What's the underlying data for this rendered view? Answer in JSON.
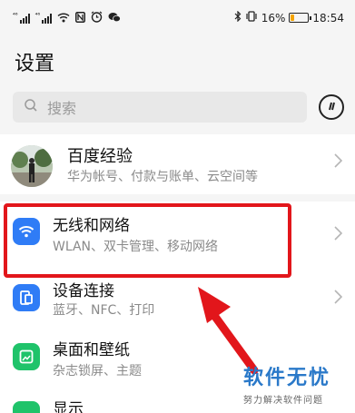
{
  "status_bar": {
    "signal_label_1": "⁴⁶",
    "signal_label_2": "⁴⁶",
    "battery_text": "16%",
    "battery_level": 0.16,
    "time": "18:54",
    "icons": [
      "signal-icon",
      "signal-icon",
      "wifi-icon",
      "nfc-icon",
      "alarm-icon",
      "wechat-icon",
      "bluetooth-icon",
      "vibrate-icon",
      "battery-icon"
    ]
  },
  "header": {
    "title": "设置"
  },
  "search": {
    "placeholder": "搜索"
  },
  "account": {
    "name": "百度经验",
    "subtitle": "华为帐号、付款与账单、云空间等"
  },
  "items": [
    {
      "title": "无线和网络",
      "subtitle": "WLAN、双卡管理、移动网络",
      "icon": "wifi-icon",
      "color": "#2f7cf6"
    },
    {
      "title": "设备连接",
      "subtitle": "蓝牙、NFC、打印",
      "icon": "device-connect-icon",
      "color": "#2f7cf6"
    },
    {
      "title": "桌面和壁纸",
      "subtitle": "杂志锁屏、主题",
      "icon": "wallpaper-icon",
      "color": "#1fc36a"
    },
    {
      "title": "显示",
      "subtitle": "",
      "icon": "display-icon",
      "color": "#1fc36a"
    }
  ],
  "annotation_color": "#e2161b",
  "watermark": {
    "main": "软件无忧",
    "sub": "努力解决软件问题"
  }
}
